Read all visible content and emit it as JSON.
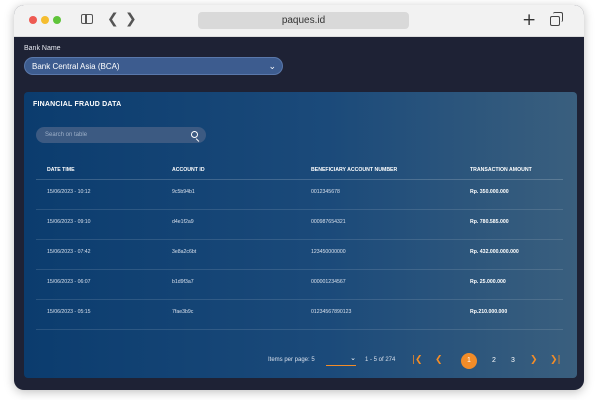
{
  "browser": {
    "url": "paques.id"
  },
  "bank": {
    "label": "Bank Name",
    "selected": "Bank Central Asia (BCA)"
  },
  "panel": {
    "title": "FINANCIAL FRAUD DATA",
    "search_placeholder": "Search on table",
    "columns": [
      "DATE TIME",
      "ACCOUNT ID",
      "BENEFICIARY ACCOUNT NUMBER",
      "TRANSACTION AMOUNT"
    ],
    "rows": [
      {
        "date": "15/06/2023 - 10:12",
        "account": "9c5b94b1",
        "beneficiary": "0012345678",
        "amount": "Rp. 350.000.000"
      },
      {
        "date": "15/06/2023 - 09:10",
        "account": "d4e1f2a9",
        "beneficiary": "000987654321",
        "amount": "Rp. 780.585.000"
      },
      {
        "date": "15/06/2023 - 07:42",
        "account": "3e8a2c6bt",
        "beneficiary": "123450000000",
        "amount": "Rp. 432.000.000.000"
      },
      {
        "date": "15/06/2023 - 06:07",
        "account": "b1d9f3a7",
        "beneficiary": "000001234567",
        "amount": "Rp. 25.000.000"
      },
      {
        "date": "15/06/2023 - 05:15",
        "account": "7fae3b9c",
        "beneficiary": "01234567890123",
        "amount": "Rp.210.000.000"
      }
    ]
  },
  "pagination": {
    "items_per_page_label": "Items per page: 5",
    "range": "1 - 5 of 274",
    "pages": [
      "1",
      "2",
      "3"
    ],
    "current_page": "1"
  },
  "colors": {
    "accent": "#f28c28",
    "panel_start": "#0b3c6e",
    "panel_end": "#3a5f7e",
    "background": "#1e2235"
  }
}
